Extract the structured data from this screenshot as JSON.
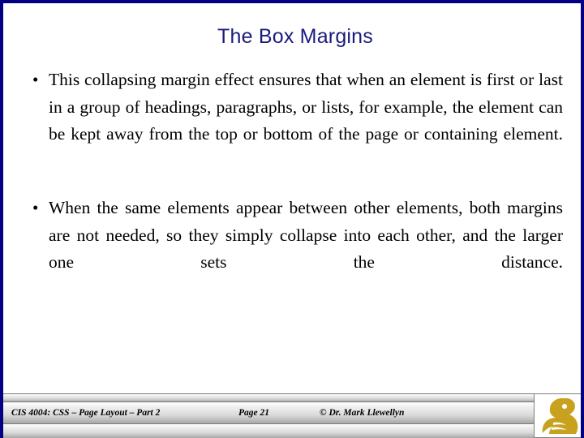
{
  "slide": {
    "title": "The Box Margins",
    "border_color": "#000080",
    "title_color": "#1b1b7d",
    "background": "#ffffff"
  },
  "content": {
    "bullets": [
      {
        "marker": "•",
        "text": "This collapsing margin effect ensures that when an element is first or last in a group of headings, paragraphs, or lists, for example, the element can be kept away from the top or bottom of the page or containing element."
      },
      {
        "marker": "•",
        "text": "When the same elements appear between other elements, both margins are not needed, so they simply collapse into each other, and the larger one sets the distance."
      }
    ]
  },
  "footer": {
    "course": "CIS 4004: CSS – Page Layout – Part 2",
    "page": "Page 21",
    "copyright": "© Dr. Mark Llewellyn",
    "logo_name": "ucf-pegasus-logo",
    "logo_color": "#C8A21E"
  }
}
